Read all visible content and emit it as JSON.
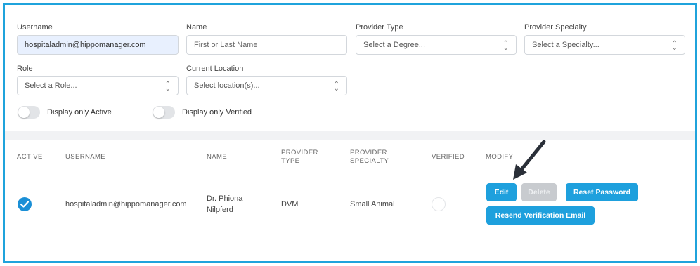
{
  "filters": {
    "username": {
      "label": "Username",
      "value": "hospitaladmin@hippomanager.com"
    },
    "name": {
      "label": "Name",
      "placeholder": "First or Last Name"
    },
    "provider_type": {
      "label": "Provider Type",
      "value": "Select a Degree..."
    },
    "provider_specialty": {
      "label": "Provider Specialty",
      "value": "Select a Specialty..."
    },
    "role": {
      "label": "Role",
      "value": "Select a Role..."
    },
    "current_location": {
      "label": "Current Location",
      "value": "Select location(s)..."
    },
    "toggle_active": {
      "label": "Display only Active",
      "on": false
    },
    "toggle_verified": {
      "label": "Display only Verified",
      "on": false
    }
  },
  "table": {
    "headers": {
      "active": "ACTIVE",
      "username": "USERNAME",
      "name": "NAME",
      "provider_type": [
        "PROVIDER",
        "TYPE"
      ],
      "provider_specialty": [
        "PROVIDER",
        "SPECIALTY"
      ],
      "verified": "VERIFIED",
      "modify": "MODIFY"
    },
    "rows": [
      {
        "active": true,
        "username": "hospitaladmin@hippomanager.com",
        "name": [
          "Dr. Phiona",
          "Nilpferd"
        ],
        "provider_type": "DVM",
        "provider_specialty": "Small Animal",
        "verified": false,
        "actions": {
          "edit": "Edit",
          "delete": "Delete",
          "reset_password": "Reset Password",
          "resend_verification": "Resend Verification Email"
        }
      }
    ]
  },
  "colors": {
    "accent": "#1ea0dd",
    "frame_border": "#1fa3dc",
    "check": "#1a8fd6",
    "disabled": "#c8cbcf"
  },
  "icons": {
    "select_caret": "up-down-chevron-icon",
    "active_check": "checkmark-circle-icon",
    "annotation": "pointer-arrow-icon"
  }
}
